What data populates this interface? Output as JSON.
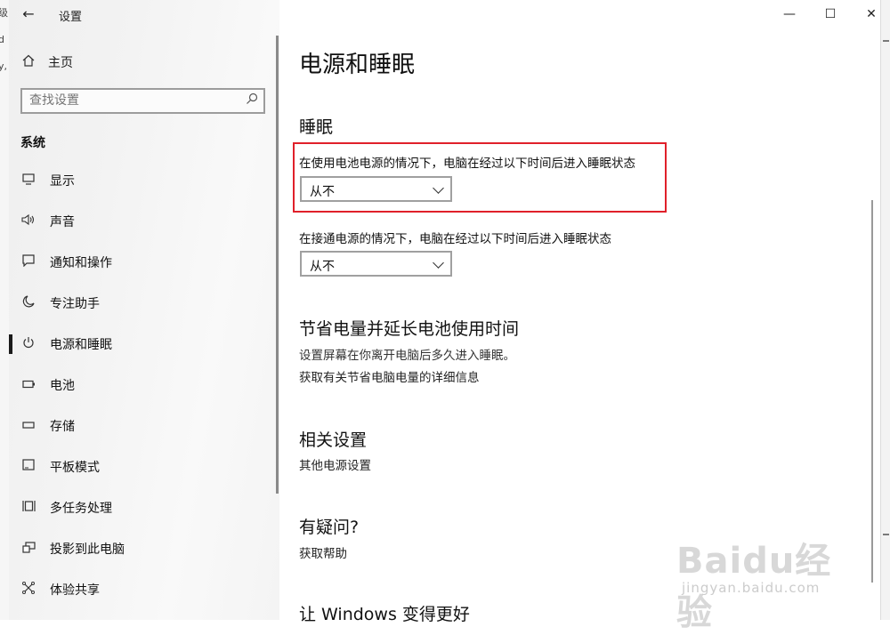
{
  "background_window": {
    "edge_chars": [
      "级",
      "d",
      "y,"
    ]
  },
  "window": {
    "title": "设置",
    "back_glyph": "←",
    "controls": {
      "minimize": "—",
      "maximize": "☐",
      "close": "✕"
    }
  },
  "sidebar": {
    "home_label": "主页",
    "search_placeholder": "查找设置",
    "section_label": "系统",
    "items": [
      {
        "label": "显示",
        "icon": "monitor-icon"
      },
      {
        "label": "声音",
        "icon": "speaker-icon"
      },
      {
        "label": "通知和操作",
        "icon": "message-icon"
      },
      {
        "label": "专注助手",
        "icon": "moon-icon"
      },
      {
        "label": "电源和睡眠",
        "icon": "power-icon",
        "active": true
      },
      {
        "label": "电池",
        "icon": "battery-icon"
      },
      {
        "label": "存储",
        "icon": "storage-icon"
      },
      {
        "label": "平板模式",
        "icon": "tablet-icon"
      },
      {
        "label": "多任务处理",
        "icon": "multitask-icon"
      },
      {
        "label": "投影到此电脑",
        "icon": "project-icon"
      },
      {
        "label": "体验共享",
        "icon": "share-icon"
      }
    ]
  },
  "main": {
    "page_title": "电源和睡眠",
    "sleep": {
      "heading": "睡眠",
      "battery_label": "在使用电池电源的情况下，电脑在经过以下时间后进入睡眠状态",
      "battery_value": "从不",
      "plugged_label": "在接通电源的情况下，电脑在经过以下时间后进入睡眠状态",
      "plugged_value": "从不"
    },
    "save_power": {
      "heading": "节省电量并延长电池使用时间",
      "desc": "设置屏幕在你离开电脑后多久进入睡眠。",
      "link": "获取有关节省电脑电量的详细信息"
    },
    "related": {
      "heading": "相关设置",
      "link": "其他电源设置"
    },
    "questions": {
      "heading": "有疑问?",
      "link": "获取帮助"
    },
    "improve": {
      "heading": "让 Windows 变得更好"
    }
  },
  "watermark": {
    "main": "Baidu经验",
    "sub": "jingyan.baidu.com"
  },
  "colors": {
    "highlight_border": "#e0202a",
    "sidebar_bg": "#f2f2f2"
  }
}
